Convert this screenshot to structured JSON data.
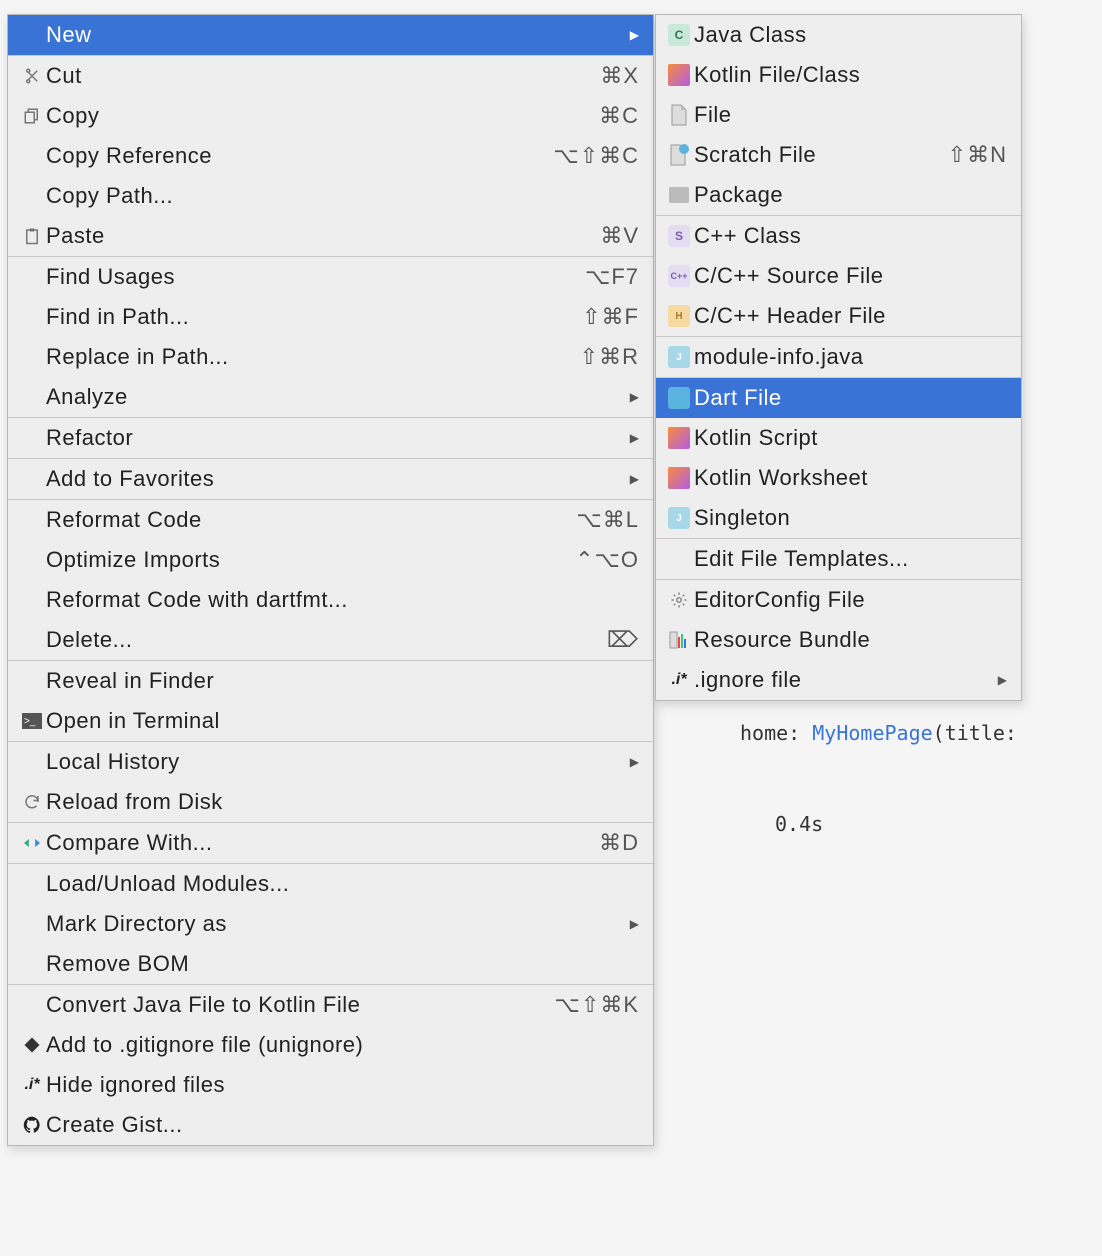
{
  "main_menu": {
    "items": [
      {
        "label": "New",
        "shortcut": "",
        "icon": "",
        "has_submenu": true,
        "selected": true
      },
      {
        "sep": true
      },
      {
        "label": "Cut",
        "shortcut": "⌘X",
        "icon": "scissors"
      },
      {
        "label": "Copy",
        "shortcut": "⌘C",
        "icon": "copy"
      },
      {
        "label": "Copy Reference",
        "shortcut": "⌥⇧⌘C",
        "icon": ""
      },
      {
        "label": "Copy Path...",
        "shortcut": "",
        "icon": ""
      },
      {
        "label": "Paste",
        "shortcut": "⌘V",
        "icon": "paste"
      },
      {
        "sep": true
      },
      {
        "label": "Find Usages",
        "shortcut": "⌥F7",
        "icon": ""
      },
      {
        "label": "Find in Path...",
        "shortcut": "⇧⌘F",
        "icon": ""
      },
      {
        "label": "Replace in Path...",
        "shortcut": "⇧⌘R",
        "icon": ""
      },
      {
        "label": "Analyze",
        "shortcut": "",
        "icon": "",
        "has_submenu": true
      },
      {
        "sep": true
      },
      {
        "label": "Refactor",
        "shortcut": "",
        "icon": "",
        "has_submenu": true
      },
      {
        "sep": true
      },
      {
        "label": "Add to Favorites",
        "shortcut": "",
        "icon": "",
        "has_submenu": true
      },
      {
        "sep": true
      },
      {
        "label": "Reformat Code",
        "shortcut": "⌥⌘L",
        "icon": ""
      },
      {
        "label": "Optimize Imports",
        "shortcut": "⌃⌥O",
        "icon": ""
      },
      {
        "label": "Reformat Code with dartfmt...",
        "shortcut": "",
        "icon": ""
      },
      {
        "label": "Delete...",
        "shortcut": "⌦",
        "icon": ""
      },
      {
        "sep": true
      },
      {
        "label": "Reveal in Finder",
        "shortcut": "",
        "icon": ""
      },
      {
        "label": "Open in Terminal",
        "shortcut": "",
        "icon": "terminal"
      },
      {
        "sep": true
      },
      {
        "label": "Local History",
        "shortcut": "",
        "icon": "",
        "has_submenu": true
      },
      {
        "label": "Reload from Disk",
        "shortcut": "",
        "icon": "reload"
      },
      {
        "sep": true
      },
      {
        "label": "Compare With...",
        "shortcut": "⌘D",
        "icon": "compare"
      },
      {
        "sep": true
      },
      {
        "label": "Load/Unload Modules...",
        "shortcut": "",
        "icon": ""
      },
      {
        "label": "Mark Directory as",
        "shortcut": "",
        "icon": "",
        "has_submenu": true
      },
      {
        "label": "Remove BOM",
        "shortcut": "",
        "icon": ""
      },
      {
        "sep": true
      },
      {
        "label": "Convert Java File to Kotlin File",
        "shortcut": "⌥⇧⌘K",
        "icon": ""
      },
      {
        "label": "Add to .gitignore file (unignore)",
        "shortcut": "",
        "icon": "diamond"
      },
      {
        "label": "Hide ignored files",
        "shortcut": "",
        "icon": "ignore"
      },
      {
        "label": "Create Gist...",
        "shortcut": "",
        "icon": "github"
      }
    ]
  },
  "sub_menu": {
    "items": [
      {
        "label": "Java Class",
        "icon": "java-c"
      },
      {
        "label": "Kotlin File/Class",
        "icon": "kotlin"
      },
      {
        "label": "File",
        "icon": "file"
      },
      {
        "label": "Scratch File",
        "shortcut": "⇧⌘N",
        "icon": "scratch"
      },
      {
        "label": "Package",
        "icon": "package"
      },
      {
        "sep": true
      },
      {
        "label": "C++ Class",
        "icon": "cpp-class"
      },
      {
        "label": "C/C++ Source File",
        "icon": "cpp-src"
      },
      {
        "label": "C/C++ Header File",
        "icon": "cpp-hdr"
      },
      {
        "sep": true
      },
      {
        "label": "module-info.java",
        "icon": "module"
      },
      {
        "sep": true
      },
      {
        "label": "Dart File",
        "icon": "dart",
        "selected": true
      },
      {
        "label": "Kotlin Script",
        "icon": "kotlin"
      },
      {
        "label": "Kotlin Worksheet",
        "icon": "kotlin"
      },
      {
        "label": "Singleton",
        "icon": "module"
      },
      {
        "sep": true
      },
      {
        "label": "Edit File Templates...",
        "icon": ""
      },
      {
        "sep": true
      },
      {
        "label": "EditorConfig File",
        "icon": "gear"
      },
      {
        "label": "Resource Bundle",
        "icon": "bundle"
      },
      {
        "label": ".ignore file",
        "icon": "ignore",
        "has_submenu": true
      }
    ]
  },
  "bg": {
    "code_fragment": "home: MyHomePage(title:",
    "time": "0.4s"
  }
}
